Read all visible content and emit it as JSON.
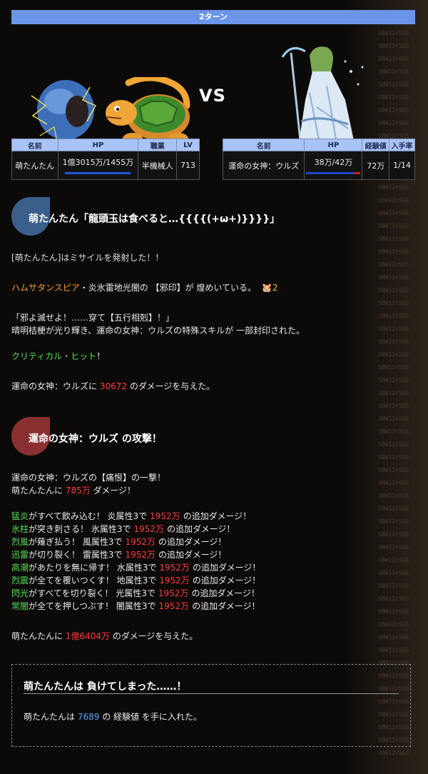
{
  "turn": "2ターン",
  "vs_label": "VS",
  "player_table": {
    "headers": [
      "名前",
      "HP",
      "職業",
      "LV"
    ],
    "name": "萌たんたん",
    "hp": "1億3015万/1455万",
    "job": "半機械人",
    "lv": "713",
    "hp_fill": 1.0
  },
  "enemy_table": {
    "headers": [
      "名前",
      "HP",
      "経験値",
      "入手率"
    ],
    "name": "運命の女神：ウルズ",
    "hp": "38万/42万",
    "exp": "72万",
    "rate": "1/14",
    "hp_fill": 0.9
  },
  "player_attack": {
    "title": "萌たんたん「龍頭玉は食べると…{{{{(+ω+)}}}}」",
    "line1": "[萌たんたん]はミサイルを発射した！！",
    "spear_name": "ハムサタンスピア",
    "spear_text": "・炎氷雷地光闇の 【邪印】が 煌めいている。",
    "spear_count": "2",
    "quote": "「邪よ滅せよ！……穿て【五行相剋】！」",
    "seal_text": "晴明桔梗が光り輝き、運命の女神：ウルズの特殊スキルが 一部封印された。",
    "critical": "クリティカル・ヒット",
    "critical_mark": "！",
    "damage_pre": "運命の女神：ウルズに",
    "damage_value": "30672",
    "damage_post": "のダメージを与えた。"
  },
  "enemy_attack": {
    "title": "運命の女神：ウルズ の攻撃！",
    "line1": "運命の女神：ウルズの【痛恨】の一撃！",
    "line2_pre": "萌たんたんに",
    "line2_value": "785万",
    "line2_post": "ダメージ！",
    "elements": [
      {
        "name": "猛炎",
        "text": "がすべて飲み込む！ 炎属性3で",
        "value": "1952万",
        "post": "の追加ダメージ！"
      },
      {
        "name": "氷柱",
        "text": "が突き刺さる！ 氷属性3で",
        "value": "1952万",
        "post": "の追加ダメージ！"
      },
      {
        "name": "烈風",
        "text": "が薙ぎ払う！ 風属性3で",
        "value": "1952万",
        "post": "の追加ダメージ！"
      },
      {
        "name": "迅雷",
        "text": "が切り裂く！ 雷属性3で",
        "value": "1952万",
        "post": "の追加ダメージ！"
      },
      {
        "name": "高潮",
        "text": "があたりを無に帰す！ 水属性3で",
        "value": "1952万",
        "post": "の追加ダメージ！"
      },
      {
        "name": "烈震",
        "text": "が全てを覆いつくす！ 地属性3で",
        "value": "1952万",
        "post": "の追加ダメージ！"
      },
      {
        "name": "閃光",
        "text": "がすべてを切り裂く！ 光属性3で",
        "value": "1952万",
        "post": "の追加ダメージ！"
      },
      {
        "name": "常闇",
        "text": "が全てを押しつぶす！ 闇属性3で",
        "value": "1952万",
        "post": "の追加ダメージ！"
      }
    ],
    "total_pre": "萌たんたんに",
    "total_value": "1億6404万",
    "total_post": "のダメージを与えた。"
  },
  "result": {
    "title": "萌たんたんは 負けてしまった……！",
    "text_pre": "萌たんたんは",
    "exp_value": "7689",
    "text_post": "の 経験値 を手に入れた。"
  },
  "colors": {
    "turn_bar": "#6b95e9",
    "player_blob": "#3a5f8a",
    "enemy_blob": "#8a3030",
    "damage": "#ff3a3a",
    "element": "#55e055",
    "spear": "#ff9a2a",
    "exp": "#4aa8ff"
  }
}
